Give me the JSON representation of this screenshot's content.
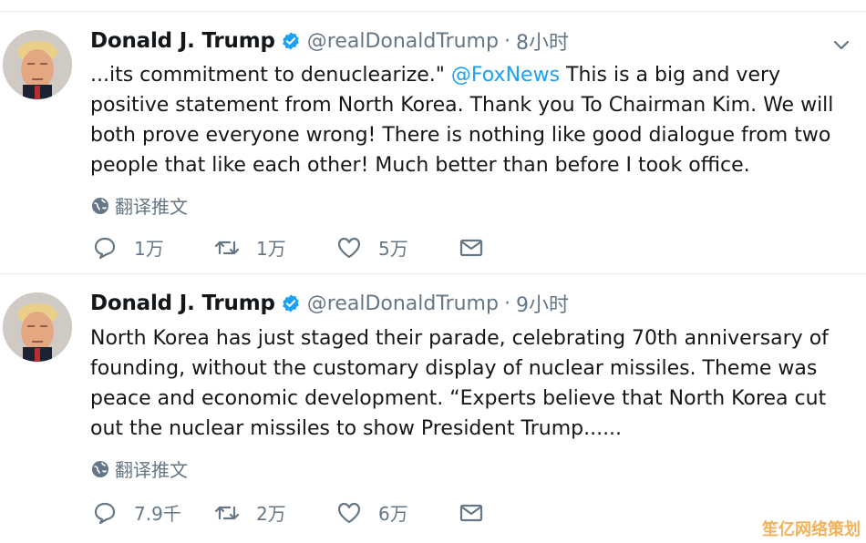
{
  "tweets": [
    {
      "name": "Donald J. Trump",
      "handle": "@realDonaldTrump",
      "separator": "·",
      "time": "8小时",
      "text_before": "...its commitment to denuclearize.\" ",
      "mention": "@FoxNews",
      "text_after": "  This is a big and very positive statement from North Korea. Thank you To Chairman Kim. We will both prove everyone wrong! There is nothing like good dialogue from two people that like each other! Much better than before I took office.",
      "translate_label": "翻译推文",
      "reply_count": "1万",
      "retweet_count": "1万",
      "like_count": "5万"
    },
    {
      "name": "Donald J. Trump",
      "handle": "@realDonaldTrump",
      "separator": "·",
      "time": "9小时",
      "text": "North Korea has just staged their parade, celebrating 70th anniversary of founding, without the customary display of nuclear missiles. Theme was peace and economic development. “Experts believe that North Korea cut out the nuclear missiles to show President Trump......",
      "translate_label": "翻译推文",
      "reply_count": "7.9千",
      "retweet_count": "2万",
      "like_count": "6万"
    }
  ],
  "icons": {
    "verified": "verified-badge-icon",
    "caret": "chevron-down-icon",
    "translate": "globe-icon",
    "reply": "reply-icon",
    "retweet": "retweet-icon",
    "like": "heart-icon",
    "message": "direct-message-icon"
  },
  "colors": {
    "link": "#1da1f2",
    "secondary": "#657786",
    "divider": "#e1e8ed",
    "watermark": "#f2b25a"
  },
  "watermark": "笙亿网络策划"
}
